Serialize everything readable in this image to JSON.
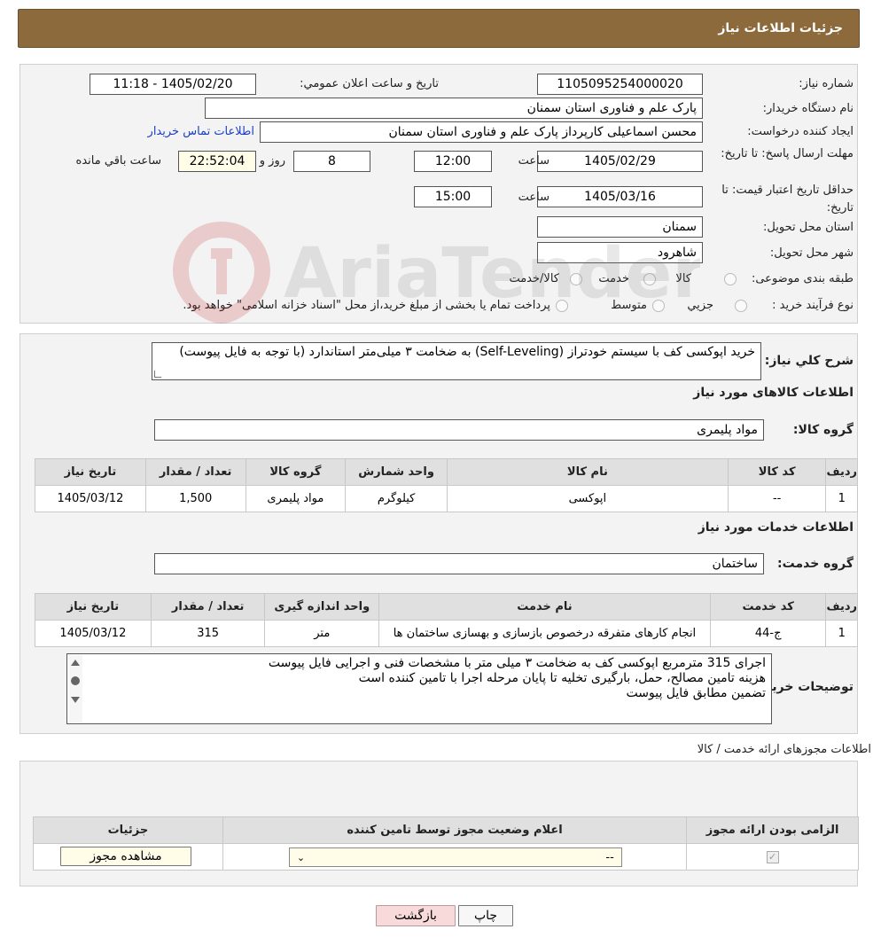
{
  "header": {
    "title": "جزئیات اطلاعات نیاز"
  },
  "labels": {
    "need_number": "شماره نیاز:",
    "announce_datetime": "تاریخ و ساعت اعلان عمومي:",
    "buyer_org": "نام دستگاه خریدار:",
    "requester": "ایجاد کننده درخواست:",
    "contact_link": "اطلاعات تماس خریدار",
    "deadline": "مهلت ارسال پاسخ: تا تاریخ:",
    "time": "ساعت",
    "day_and": "روز و",
    "remaining": "ساعت باقي مانده",
    "price_validity": "حداقل تاریخ اعتبار قیمت: تا تاریخ:",
    "province": "استان محل تحویل:",
    "city": "شهر محل تحویل:",
    "category": "طبقه بندی موضوعی:",
    "purchase_type": "نوع فرآیند خرید :",
    "description": "شرح کلي نیاز:",
    "goods_info": "اطلاعات کالاهای مورد نیاز",
    "goods_group": "گروه کالا:",
    "services_info": "اطلاعات خدمات مورد نیاز",
    "service_group": "گروه خدمت:",
    "buyer_notes": "توضیحات خریدار:",
    "permits_title": "اطلاعات مجوزهای ارائه خدمت / کالا"
  },
  "values": {
    "need_number": "1105095254000020",
    "announce_datetime": "1405/02/20 - 11:18",
    "buyer_org": "پارک علم و فناوری استان سمنان",
    "requester": "محسن اسماعیلی کارپرداز پارک علم و فناوری استان سمنان",
    "deadline_date": "1405/02/29",
    "deadline_time": "12:00",
    "days": "8",
    "remaining_time": "22:52:04",
    "validity_date": "1405/03/16",
    "validity_time": "15:00",
    "province": "سمنان",
    "city": "شاهرود",
    "description": "خرید اپوکسی کف با سیستم خودتراز (Self-Leveling) به ضخامت ۳ میلی‌متر استاندارد (با توجه به فایل پیوست)",
    "goods_group": "مواد پلیمری",
    "service_group": "ساختمان"
  },
  "category_options": [
    {
      "label": "کالا",
      "selected": false
    },
    {
      "label": "خدمت",
      "selected": false
    },
    {
      "label": "کالا/خدمت",
      "selected": false
    }
  ],
  "purchase_options": [
    {
      "label": "جزیي",
      "selected": false
    },
    {
      "label": "متوسط",
      "selected": false
    },
    {
      "label": "پرداخت تمام یا بخشی از مبلغ خرید،از محل \"اسناد خزانه اسلامی\" خواهد بود.",
      "selected": false
    }
  ],
  "goods_table": {
    "headers": [
      "ردیف",
      "کد کالا",
      "نام کالا",
      "واحد شمارش",
      "گروه کالا",
      "تعداد / مقدار",
      "تاریخ نیاز"
    ],
    "rows": [
      [
        "1",
        "--",
        "اپوکسی",
        "کیلوگرم",
        "مواد پلیمری",
        "1,500",
        "1405/03/12"
      ]
    ]
  },
  "services_table": {
    "headers": [
      "ردیف",
      "کد خدمت",
      "نام خدمت",
      "واحد اندازه گیری",
      "تعداد / مقدار",
      "تاریخ نیاز"
    ],
    "rows": [
      [
        "1",
        "ج-44",
        "انجام کارهای متفرقه درخصوص بازسازی و بهسازی ساختمان ها",
        "متر",
        "315",
        "1405/03/12"
      ]
    ]
  },
  "buyer_notes_lines": [
    "اجرای 315 مترمربع اپوکسی کف به ضخامت ۳ میلی متر با مشخصات فنی و اجرایی فایل پیوست",
    "هزینه تامین مصالح، حمل، بارگیری  تخلیه تا پایان مرحله اجرا با تامین کننده است",
    "تضمین مطابق فایل پیوست"
  ],
  "permits_table": {
    "headers": [
      "الزامی بودن ارائه مجوز",
      "اعلام وضعیت مجوز توسط تامین کننده",
      "جزئیات"
    ],
    "select_value": "--",
    "view_button": "مشاهده مجوز"
  },
  "buttons": {
    "print": "چاپ",
    "back": "بازگشت"
  },
  "watermark": {
    "text": "AriaTender.neT"
  },
  "colors": {
    "header": "#8c6a3c",
    "back_button": "#f8dada",
    "link": "#1a3ec8"
  }
}
